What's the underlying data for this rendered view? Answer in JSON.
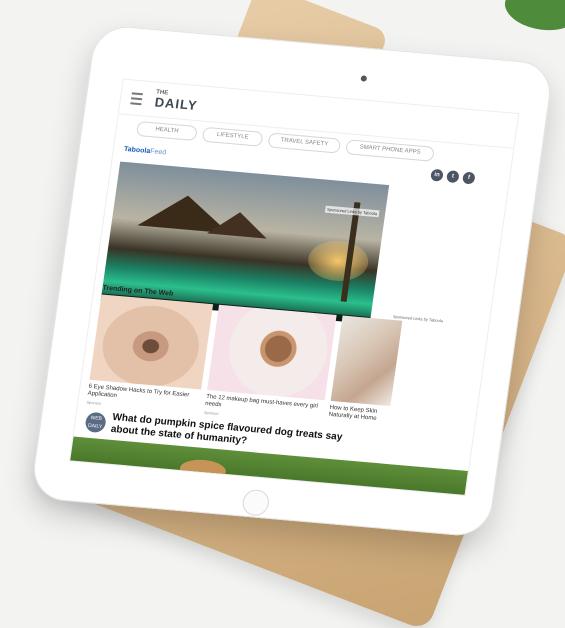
{
  "header": {
    "logo_top": "THE",
    "logo_main": "DAILY"
  },
  "pills": [
    "HEALTH",
    "LIFESTYLE",
    "TRAVEL SAFETY",
    "SMART PHONE APPS"
  ],
  "feed": {
    "brand": "Taboola",
    "brand_suffix": "Feed",
    "trending_label": "Trending on The Web",
    "hero_sponsor": "Sponsored Links by Taboola",
    "cards_sponsor": "Sponsored Links by Taboola"
  },
  "social": [
    {
      "icon": "linkedin-icon",
      "glyph": "in"
    },
    {
      "icon": "twitter-icon",
      "glyph": "t"
    },
    {
      "icon": "facebook-icon",
      "glyph": "f"
    }
  ],
  "cards": [
    {
      "title": "6 Eye Shadow Hacks to Try for Easier Application",
      "source": "Sponsor"
    },
    {
      "title": "The 12 makeup bag must-haves every girl needs",
      "source": "Sponsor"
    },
    {
      "title": "How to Keep Skin Naturally at Home",
      "source": "Sponsor"
    }
  ],
  "article": {
    "badge": "WEB DAILY",
    "headline": "What do pumpkin spice flavoured dog treats say about the state of humanity?"
  }
}
